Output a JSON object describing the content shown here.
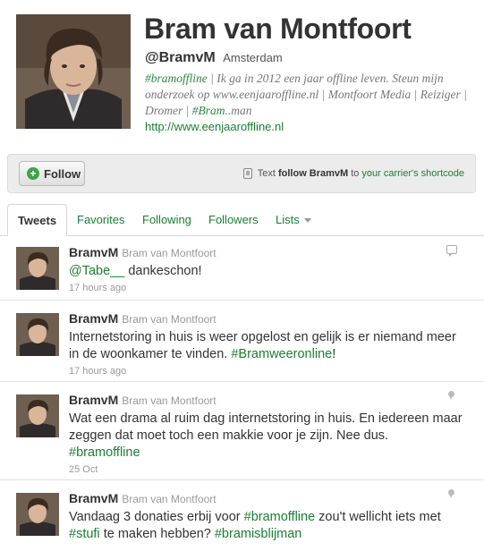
{
  "profile": {
    "name": "Bram van Montfoort",
    "handle": "@BramvM",
    "location": "Amsterdam",
    "bio_tag1": "#bramoffline",
    "bio_text1": " | Ik ga in 2012 een jaar offline leven. Steun mijn onderzoek op www.eenjaaroffline.nl | Montfoort Media | Reiziger | Dromer | ",
    "bio_tag2": "#Bram",
    "bio_text2": "..man",
    "url": "http://www.eenjaaroffline.nl"
  },
  "actions": {
    "follow_label": "Follow",
    "sms_prefix": "Text",
    "sms_bold": "follow BramvM",
    "sms_to": "to",
    "sms_link": "your carrier's shortcode"
  },
  "tabs": [
    "Tweets",
    "Favorites",
    "Following",
    "Followers",
    "Lists"
  ],
  "tweets": [
    {
      "user": "BramvM",
      "fullname": "Bram van Montfoort",
      "mention": "@Tabe__",
      "text": " dankeschon!",
      "time": "17 hours ago"
    },
    {
      "user": "BramvM",
      "fullname": "Bram van Montfoort",
      "text": "Internetstoring in huis is weer opgelost en gelijk is er niemand meer in de woonkamer te vinden. ",
      "hashtag": "#Bramweeronline",
      "text_end": "!",
      "time": "17 hours ago"
    },
    {
      "user": "BramvM",
      "fullname": "Bram van Montfoort",
      "text": "Wat een drama al ruim dag internetstoring in huis. En iedereen maar zeggen dat moet toch een makkie voor je zijn. Nee dus.",
      "hashtag": "#bramoffline",
      "time": "25 Oct"
    },
    {
      "user": "BramvM",
      "fullname": "Bram van Montfoort",
      "text1": "Vandaag 3 donaties erbij voor ",
      "hashtag1": "#bramoffline",
      "text2": " zou't wellicht iets met ",
      "hashtag2": "#stufi",
      "text3": " te maken hebben? ",
      "hashtag3": "#bramisblijman"
    }
  ],
  "colors": {
    "link_green": "#1a7f32",
    "follow_plus": "#3fa346",
    "action_bar_bg": "#ececec"
  }
}
